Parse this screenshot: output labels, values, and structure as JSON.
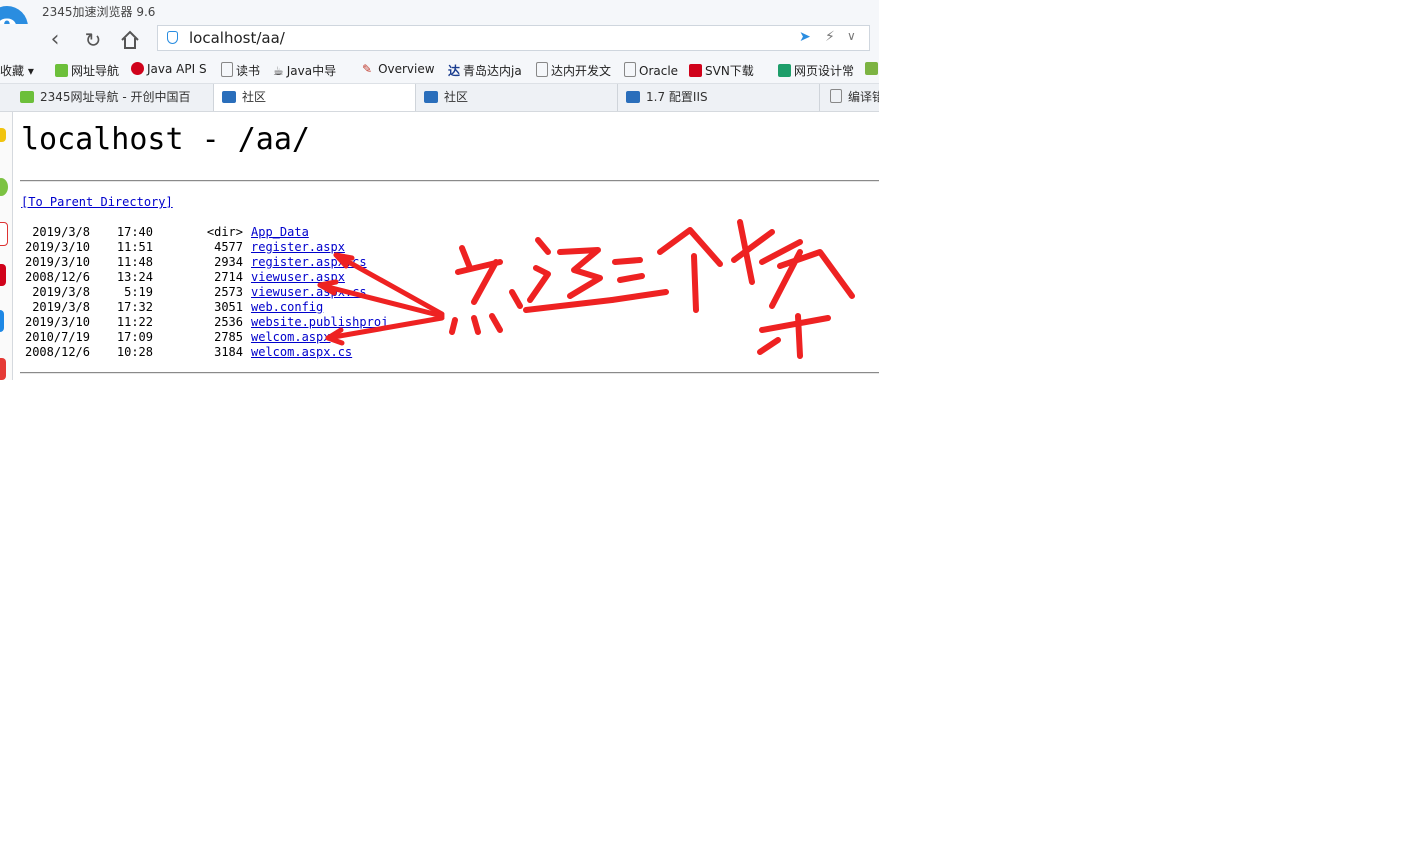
{
  "window": {
    "title": "2345加速浏览器 9.6"
  },
  "toolbar": {
    "url": "localhost/aa/"
  },
  "bookmarks": [
    {
      "label": "收藏",
      "icon": "favorites-icon"
    },
    {
      "label": "网址导航",
      "icon": "2345-icon"
    },
    {
      "label": "Java API S",
      "icon": "oracle-icon"
    },
    {
      "label": "读书",
      "icon": "page-icon"
    },
    {
      "label": "Java中导",
      "icon": "java-icon"
    },
    {
      "label": "Overview",
      "icon": "quill-icon"
    },
    {
      "label": "青岛达内ja",
      "icon": "tarena-icon"
    },
    {
      "label": "达内开发文",
      "icon": "page-icon"
    },
    {
      "label": "Oracle",
      "icon": "page-icon"
    },
    {
      "label": "SVN下载",
      "icon": "svn-icon"
    },
    {
      "label": "网页设计常",
      "icon": "design-icon"
    }
  ],
  "tabs": [
    {
      "label": "2345网址导航 - 开创中国百"
    },
    {
      "label": "社区"
    },
    {
      "label": "社区"
    },
    {
      "label": "1.7 配置IIS"
    },
    {
      "label": "编译错"
    }
  ],
  "page": {
    "title": "localhost - /aa/",
    "parent_link": "[To Parent Directory]",
    "entries": [
      {
        "date": "2019/3/8",
        "time": "17:40",
        "size": "<dir>",
        "name": "App_Data"
      },
      {
        "date": "2019/3/10",
        "time": "11:51",
        "size": "4577",
        "name": "register.aspx"
      },
      {
        "date": "2019/3/10",
        "time": "11:48",
        "size": "2934",
        "name": "register.aspx.cs"
      },
      {
        "date": "2008/12/6",
        "time": "13:24",
        "size": "2714",
        "name": "viewuser.aspx"
      },
      {
        "date": "2019/3/8",
        "time": "5:19",
        "size": "2573",
        "name": "viewuser.aspx.cs"
      },
      {
        "date": "2019/3/8",
        "time": "17:32",
        "size": "3051",
        "name": "web.config"
      },
      {
        "date": "2019/3/10",
        "time": "11:22",
        "size": "2536",
        "name": "website.publishproj"
      },
      {
        "date": "2010/7/19",
        "time": "17:09",
        "size": "2785",
        "name": "welcom.aspx"
      },
      {
        "date": "2008/12/6",
        "time": "10:28",
        "size": "3184",
        "name": "welcom.aspx.cs"
      }
    ]
  },
  "annotation": {
    "color": "#ee2222",
    "handwritten_text": "点这三个报错"
  },
  "colors": {
    "accent": "#2a8de0",
    "link": "#0000cc"
  }
}
